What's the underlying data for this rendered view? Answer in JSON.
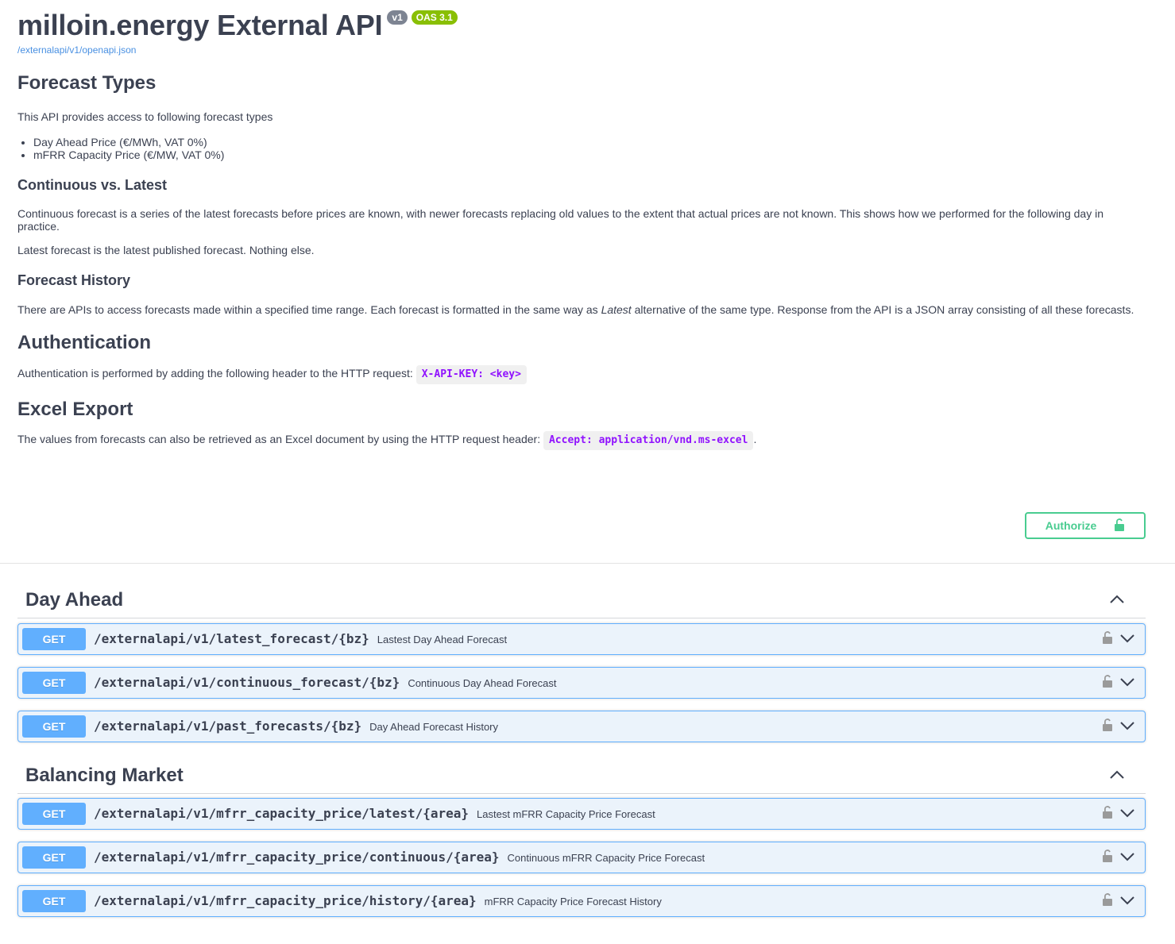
{
  "info": {
    "title": "milloin.energy External API",
    "version_badge": "v1",
    "oas_badge": "OAS 3.1",
    "spec_link": "/externalapi/v1/openapi.json"
  },
  "description": {
    "forecast_types_heading": "Forecast Types",
    "forecast_types_intro": "This API provides access to following forecast types",
    "forecast_types": [
      "Day Ahead Price (€/MWh, VAT 0%)",
      "mFRR Capacity Price (€/MW, VAT 0%)"
    ],
    "continuous_heading": "Continuous vs. Latest",
    "continuous_text": "Continuous forecast is a series of the latest forecasts before prices are known, with newer forecasts replacing old values to the extent that actual prices are not known. This shows how we performed for the following day in practice.",
    "latest_text": "Latest forecast is the latest published forecast. Nothing else.",
    "history_heading": "Forecast History",
    "history_text_before": "There are APIs to access forecasts made within a specified time range. Each forecast is formatted in the same way as ",
    "history_text_emph": "Latest",
    "history_text_after": " alternative of the same type. Response from the API is a JSON array consisting of all these forecasts.",
    "auth_heading": "Authentication",
    "auth_text": "Authentication is performed by adding the following header to the HTTP request:",
    "auth_code": "X-API-KEY: <key>",
    "excel_heading": "Excel Export",
    "excel_text": "The values from forecasts can also be retrieved as an Excel document by using the HTTP request header:",
    "excel_code": "Accept: application/vnd.ms-excel",
    "excel_text_end": "."
  },
  "authorize": {
    "label": "Authorize",
    "icon": "unlock-icon"
  },
  "tags": [
    {
      "name": "Day Ahead",
      "operations": [
        {
          "method": "GET",
          "path": "/externalapi/v1/latest_forecast/{bz}",
          "summary": "Lastest Day Ahead Forecast"
        },
        {
          "method": "GET",
          "path": "/externalapi/v1/continuous_forecast/{bz}",
          "summary": "Continuous Day Ahead Forecast"
        },
        {
          "method": "GET",
          "path": "/externalapi/v1/past_forecasts/{bz}",
          "summary": "Day Ahead Forecast History"
        }
      ]
    },
    {
      "name": "Balancing Market",
      "operations": [
        {
          "method": "GET",
          "path": "/externalapi/v1/mfrr_capacity_price/latest/{area}",
          "summary": "Lastest mFRR Capacity Price Forecast"
        },
        {
          "method": "GET",
          "path": "/externalapi/v1/mfrr_capacity_price/continuous/{area}",
          "summary": "Continuous mFRR Capacity Price Forecast"
        },
        {
          "method": "GET",
          "path": "/externalapi/v1/mfrr_capacity_price/history/{area}",
          "summary": "mFRR Capacity Price Forecast History"
        }
      ]
    }
  ],
  "colors": {
    "get_method": "#61affe",
    "get_bg": "#ebf3fb",
    "authorize": "#49cc90",
    "code": "#9012fe",
    "version_badge": "#7d8492",
    "oas_badge": "#89bf04"
  }
}
